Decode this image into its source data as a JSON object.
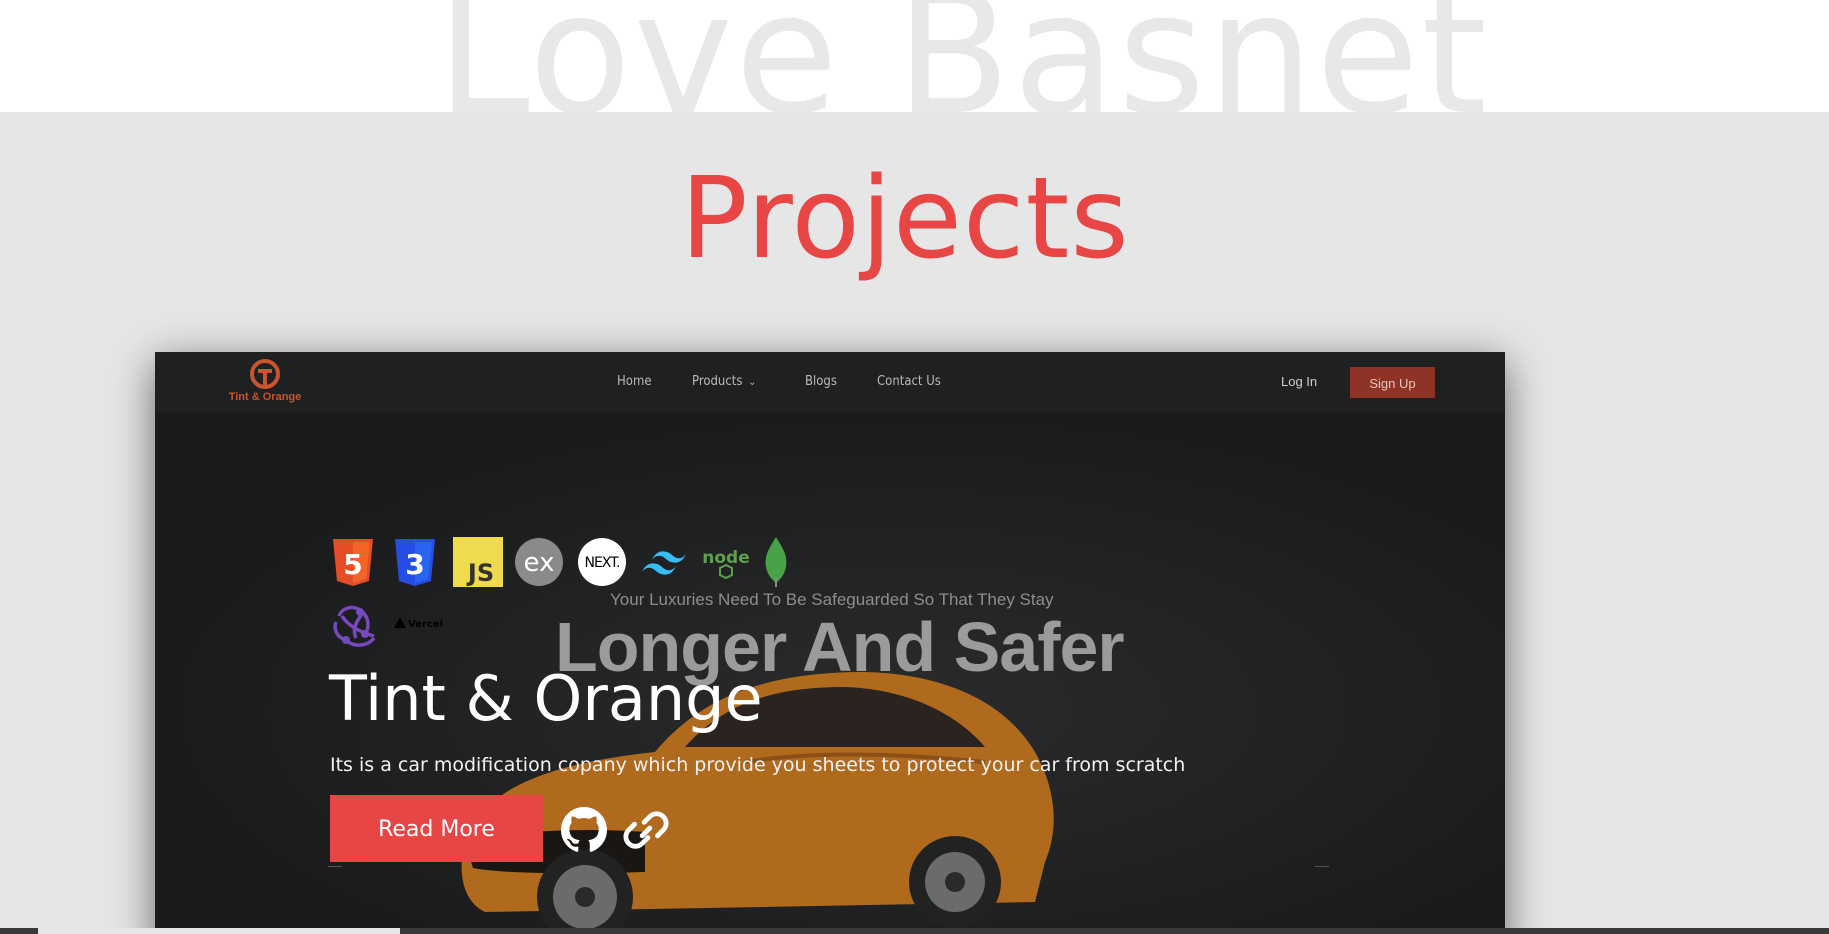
{
  "background_name": "Love Basnet",
  "section": {
    "title": "Projects",
    "title_color": "#e84545"
  },
  "project": {
    "navbar": {
      "logo_text": "Tint & Orange",
      "items": [
        "Home",
        "Products",
        "Blogs",
        "Contact Us"
      ],
      "login": "Log In",
      "signup": "Sign Up",
      "signup_color": "#8e3325"
    },
    "hero": {
      "tagline": "Your Luxuries Need To Be Safeguarded So That They Stay",
      "headline": "Longer And Safer"
    },
    "tech_stack": [
      {
        "name": "html5-icon",
        "label": "5"
      },
      {
        "name": "css3-icon",
        "label": "3"
      },
      {
        "name": "javascript-icon",
        "label": "JS"
      },
      {
        "name": "express-icon",
        "label": "ex"
      },
      {
        "name": "nextjs-icon",
        "label": "NEXT."
      },
      {
        "name": "tailwind-icon",
        "label": ""
      },
      {
        "name": "nodejs-icon",
        "label": "node"
      },
      {
        "name": "mongodb-icon",
        "label": ""
      },
      {
        "name": "redux-icon",
        "label": ""
      },
      {
        "name": "vercel-icon",
        "label": "Vercel"
      }
    ],
    "title": "Tint & Orange",
    "description": "Its is a car modification copany which provide you sheets to protect your car from scratch",
    "read_more": "Read More",
    "links": [
      "github-icon",
      "link-icon"
    ]
  }
}
